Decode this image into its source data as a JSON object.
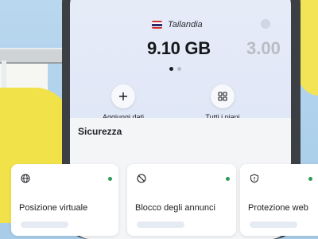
{
  "plan": {
    "country": "Tailandia",
    "data_amount": "9.10 GB",
    "next_data_amount": "3.00"
  },
  "actions": {
    "add_data": "Aggiungi dati",
    "all_plans": "Tutti i piani"
  },
  "security": {
    "title": "Sicurezza",
    "cards": [
      {
        "title": "Posizione virtuale",
        "icon": "globe-icon",
        "status": "active"
      },
      {
        "title": "Blocco degli annunci",
        "icon": "block-icon",
        "status": "active"
      },
      {
        "title": "Protezione web",
        "icon": "shield-icon",
        "status": "active"
      }
    ]
  },
  "colors": {
    "status_active": "#2e9a58",
    "background_yellow": "#f2e24a"
  }
}
